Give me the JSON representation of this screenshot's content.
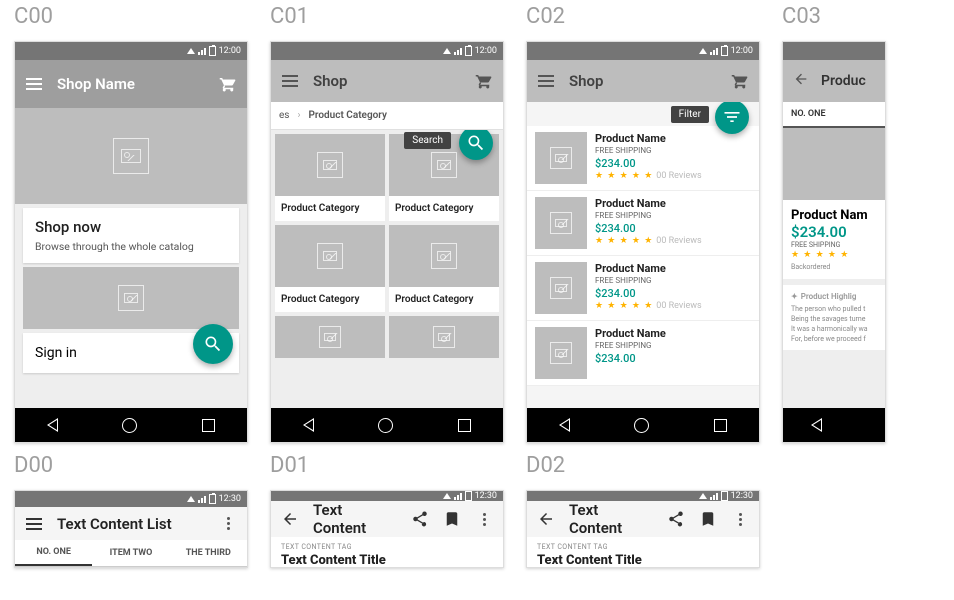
{
  "status_time": "12:00",
  "d_status_time": "12:30",
  "c00": {
    "label": "C00",
    "appbar_title": "Shop Name",
    "card_title": "Shop now",
    "card_sub": "Browse through the whole catalog",
    "signin": "Sign in"
  },
  "c01": {
    "label": "C01",
    "appbar_title": "Shop",
    "crumb_prev": "es",
    "crumb_current": "Product Category",
    "fab_label": "Search",
    "tile_caption": "Product Category"
  },
  "c02": {
    "label": "C02",
    "appbar_title": "Shop",
    "fab_label": "Filter",
    "product": {
      "name": "Product Name",
      "shipping": "FREE SHIPPING",
      "price": "$234.00",
      "reviews": "00 Reviews"
    }
  },
  "c03": {
    "label": "C03",
    "appbar_title": "Produc",
    "tab": "NO. ONE",
    "pname": "Product Nam",
    "price": "$234.00",
    "shipping": "FREE SHIPPING",
    "backorder": "Backordered",
    "hl_title": "Product Highlig",
    "hl_lines": [
      "The person who pulled t",
      "Being the savages turne",
      "It was a harmonically wa",
      "For, before we proceed f"
    ]
  },
  "d00": {
    "label": "D00",
    "title": "Text Content List",
    "tabs": [
      "NO. ONE",
      "ITEM TWO",
      "THE THIRD"
    ]
  },
  "d01": {
    "label": "D01",
    "title": "Text Content",
    "tag": "TEXT CONTENT TAG",
    "content_title": "Text Content Title"
  },
  "d02": {
    "label": "D02",
    "title": "Text Content",
    "tag": "TEXT CONTENT TAG",
    "content_title": "Text Content Title"
  },
  "stars": "★ ★ ★ ★ ★"
}
